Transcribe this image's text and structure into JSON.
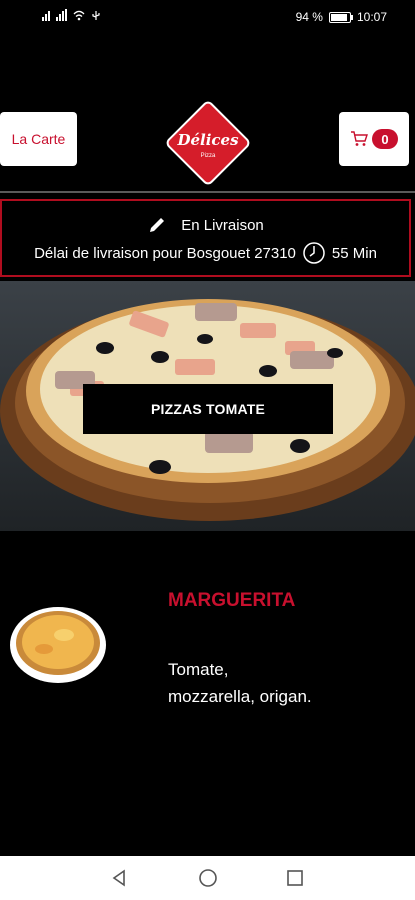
{
  "status_bar": {
    "battery_text": "94 %",
    "time": "10:07",
    "icons": [
      "signal-icon",
      "signal-icon",
      "wifi-icon",
      "usb-icon"
    ]
  },
  "header": {
    "la_carte_label": "La Carte",
    "logo_text": "Délices",
    "logo_sub": "Pizza",
    "cart_count": "0",
    "cart_icon": "cart-icon"
  },
  "delivery": {
    "mode_label": "En Livraison",
    "mode_icon": "pencil-icon",
    "delay_text": "Délai de livraison pour Bosgouet 27310",
    "clock_icon": "clock-icon",
    "delay_minutes": "55 Min"
  },
  "hero": {
    "category_label": "PIZZAS TOMATE"
  },
  "product": {
    "name": "MARGUERITA",
    "description": "Tomate, mozzarella, origan."
  },
  "nav": {
    "back_icon": "back-triangle-icon",
    "home_icon": "home-circle-icon",
    "recents_icon": "recents-square-icon"
  },
  "colors": {
    "accent": "#c8102e",
    "background": "#000000",
    "border": "#b00d1f"
  }
}
